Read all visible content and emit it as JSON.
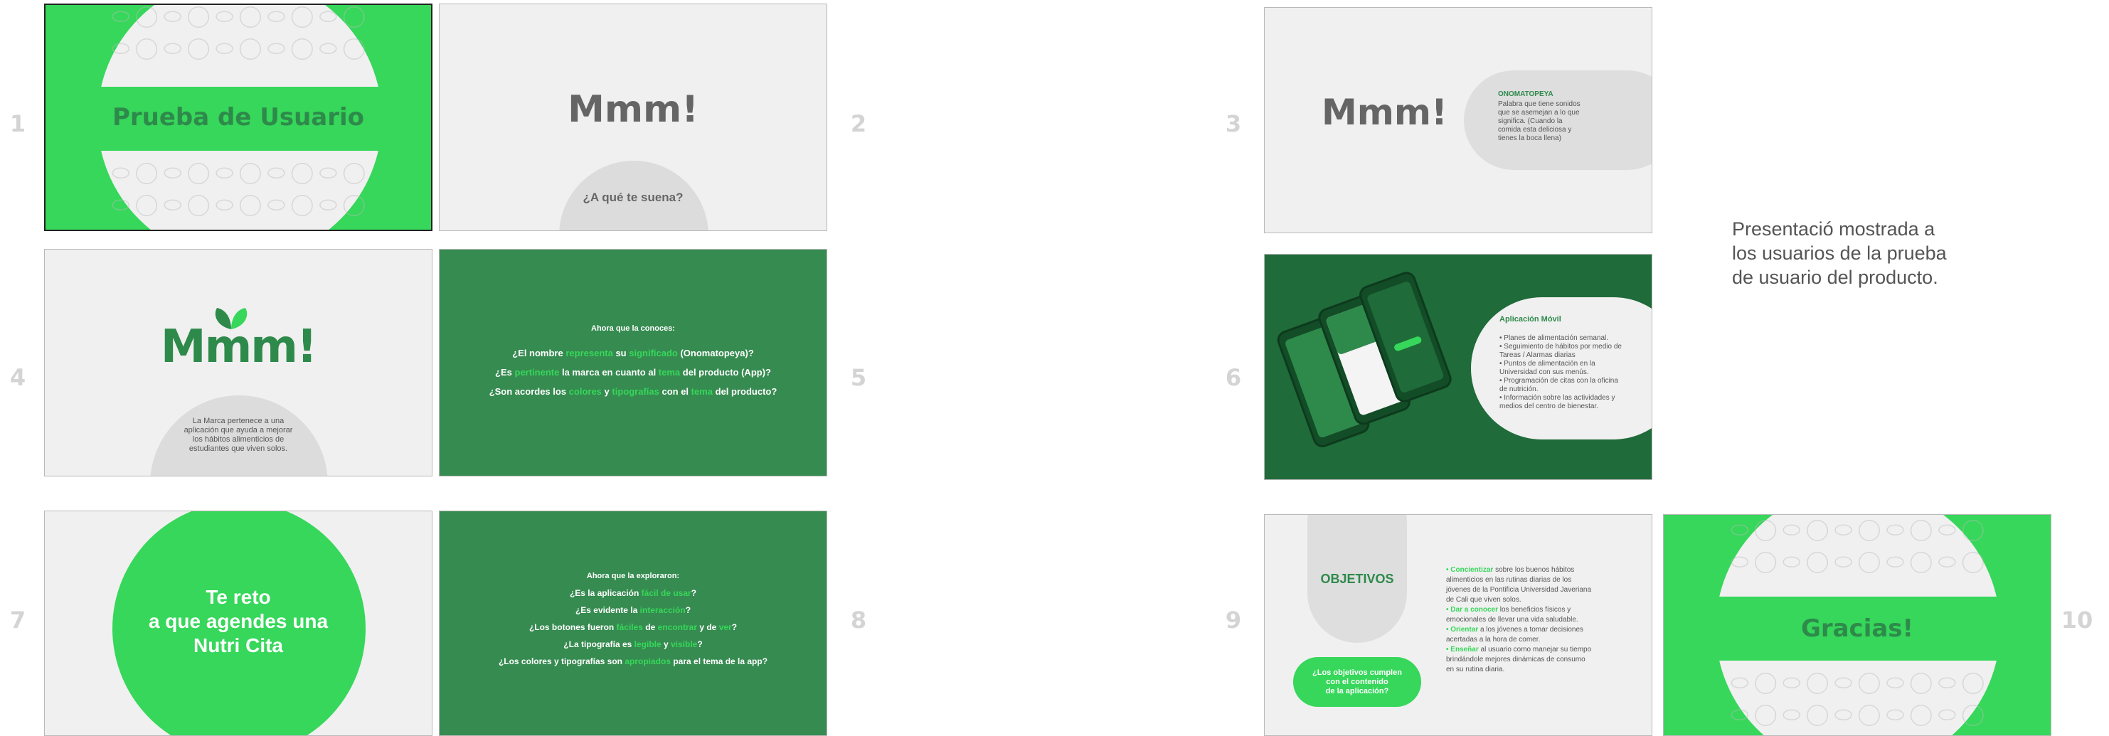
{
  "slide_numbers": [
    "1",
    "2",
    "3",
    "4",
    "5",
    "6",
    "7",
    "8",
    "9",
    "10"
  ],
  "slide1": {
    "title": "Prueba de Usuario"
  },
  "slide2": {
    "title": "Mmm!",
    "question": "¿A qué te suena?"
  },
  "slide3": {
    "title": "Mmm!",
    "def_heading": "ONOMATOPEYA",
    "def_lines": [
      "Palabra que tiene sonidos",
      "que se asemejan a lo que",
      "significa. (Cuando la",
      "comida esta deliciosa y",
      "tienes la boca llena)"
    ]
  },
  "slide4": {
    "logo": "Mmm!",
    "desc_lines": [
      "La Marca pertenece a una",
      "aplicación que ayuda a mejorar",
      "los hábitos alimenticios de",
      "estudiantes que viven solos."
    ]
  },
  "slide5": {
    "intro": "Ahora que la conoces:",
    "q1": [
      "¿El nombre ",
      "representa",
      " su ",
      "significado",
      " (Onomatopeya)?"
    ],
    "q2": [
      "¿Es ",
      "pertinente",
      " la marca en cuanto al ",
      "tema",
      " del producto (App)?"
    ],
    "q3": [
      "¿Son acordes los ",
      "colores",
      " y ",
      "tipografías",
      " con el ",
      "tema",
      " del producto?"
    ]
  },
  "slide6": {
    "heading": "Aplicación Móvil",
    "bullets": [
      [
        "• Planes de alimentación semanal."
      ],
      [
        "• Seguimiento de hábitos por medio de",
        "Tareas / Alarmas diarias"
      ],
      [
        "• Puntos de alimentación en la",
        "Universidad con sus menús."
      ],
      [
        "• Programación de citas con la oficina",
        "de nutrición."
      ],
      [
        "• Información sobre las actividades y",
        "medios del centro de bienestar."
      ]
    ]
  },
  "slide7": {
    "lines": [
      "Te reto",
      "a que agendes una",
      "Nutri Cita"
    ]
  },
  "slide8": {
    "intro": "Ahora que la exploraron:",
    "q1": [
      "¿Es la aplicación ",
      "fácil de usar",
      "?"
    ],
    "q2": [
      "¿Es evidente la ",
      "interacción",
      "?"
    ],
    "q3": [
      "¿Los botones fueron ",
      "fáciles",
      " de ",
      "encontrar",
      " y de ",
      "ver",
      "?"
    ],
    "q4": [
      "¿La tipografía es ",
      "legible",
      " y ",
      "visible",
      "?"
    ],
    "q5": [
      "¿Los colores y tipografías son ",
      "apropiados",
      " para el tema de la app?"
    ]
  },
  "slide9": {
    "heading": "OBJETIVOS",
    "button_lines": [
      "¿Los objetivos cumplen",
      "con el contenido",
      "de la aplicación?"
    ],
    "items": [
      {
        "key": "• Concientizar",
        "lines": [
          " sobre los buenos hábitos",
          "alimenticios en las rutinas diarias de los",
          "jóvenes de la Pontificia Universidad Javeriana",
          "de Cali que viven solos."
        ]
      },
      {
        "key": "• Dar a conocer",
        "lines": [
          " los beneficios físicos y",
          "emocionales de llevar una vida saludable."
        ]
      },
      {
        "key": "• Orientar",
        "lines": [
          " a los jóvenes a tomar decisiones",
          "acertadas a la hora de comer."
        ]
      },
      {
        "key": "• Enseñar",
        "lines": [
          " al usuario como manejar su tiempo",
          "brindándole mejores dinámicas de consumo",
          "en su rutina diaria."
        ]
      }
    ]
  },
  "slide10": {
    "title": "Gracias!"
  },
  "caption_lines": [
    "Presentació mostrada a",
    "los usuarios de la prueba",
    "de usuario del producto."
  ],
  "pattern_glyphs": "⬭ ◯ ⬭ ◯ ⬭ ◯ ⬭ ◯ ⬭ ◯",
  "colors": {
    "green": "#36d75a",
    "dark_green": "#368b50",
    "gray_text": "#656565",
    "light_bg": "#f0f0f0"
  }
}
